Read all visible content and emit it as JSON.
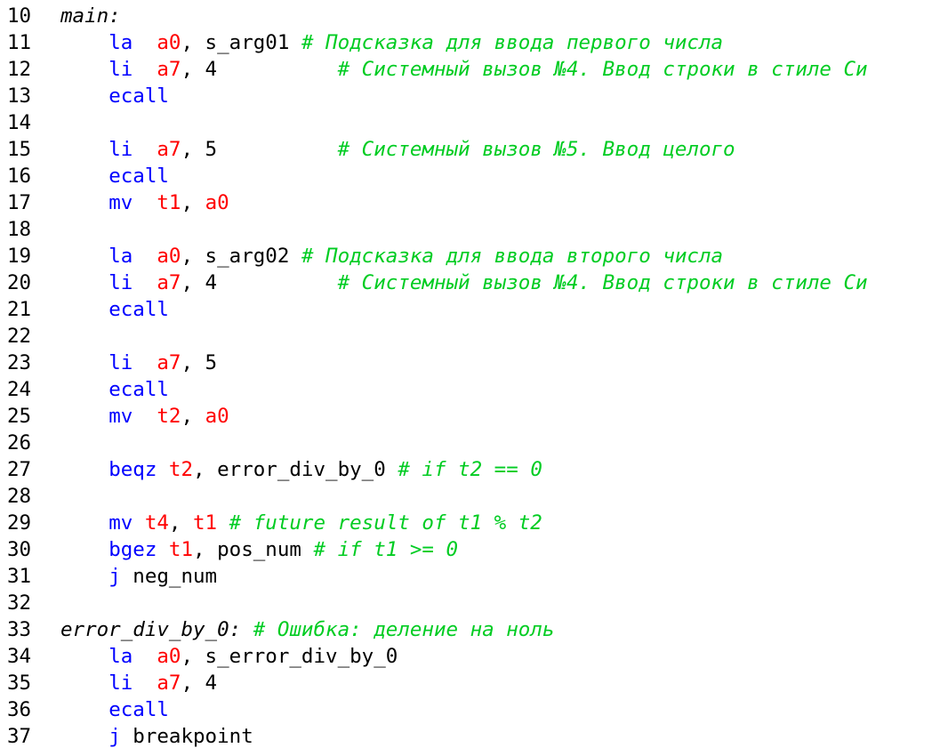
{
  "editor": {
    "colors": {
      "instruction": "#0000ff",
      "register": "#ff0000",
      "comment": "#00cc22",
      "text": "#000000",
      "background": "#ffffff"
    },
    "lines": [
      {
        "num": "10",
        "tokens": [
          {
            "t": "main:",
            "k": "label"
          }
        ]
      },
      {
        "num": "11",
        "tokens": [
          {
            "t": "    "
          },
          {
            "t": "la",
            "k": "instr"
          },
          {
            "t": "  "
          },
          {
            "t": "a0",
            "k": "reg"
          },
          {
            "t": ", s_arg01 "
          },
          {
            "t": "# Подсказка для ввода первого числа",
            "k": "comment"
          }
        ]
      },
      {
        "num": "12",
        "tokens": [
          {
            "t": "    "
          },
          {
            "t": "li",
            "k": "instr"
          },
          {
            "t": "  "
          },
          {
            "t": "a7",
            "k": "reg"
          },
          {
            "t": ", 4          "
          },
          {
            "t": "# Системный вызов №4. Ввод строки в стиле Си",
            "k": "comment"
          }
        ]
      },
      {
        "num": "13",
        "tokens": [
          {
            "t": "    "
          },
          {
            "t": "ecall",
            "k": "instr"
          }
        ]
      },
      {
        "num": "14",
        "tokens": []
      },
      {
        "num": "15",
        "tokens": [
          {
            "t": "    "
          },
          {
            "t": "li",
            "k": "instr"
          },
          {
            "t": "  "
          },
          {
            "t": "a7",
            "k": "reg"
          },
          {
            "t": ", 5          "
          },
          {
            "t": "# Системный вызов №5. Ввод целого",
            "k": "comment"
          }
        ]
      },
      {
        "num": "16",
        "tokens": [
          {
            "t": "    "
          },
          {
            "t": "ecall",
            "k": "instr"
          }
        ]
      },
      {
        "num": "17",
        "tokens": [
          {
            "t": "    "
          },
          {
            "t": "mv",
            "k": "instr"
          },
          {
            "t": "  "
          },
          {
            "t": "t1",
            "k": "reg"
          },
          {
            "t": ", "
          },
          {
            "t": "a0",
            "k": "reg"
          }
        ]
      },
      {
        "num": "18",
        "tokens": []
      },
      {
        "num": "19",
        "tokens": [
          {
            "t": "    "
          },
          {
            "t": "la",
            "k": "instr"
          },
          {
            "t": "  "
          },
          {
            "t": "a0",
            "k": "reg"
          },
          {
            "t": ", s_arg02 "
          },
          {
            "t": "# Подсказка для ввода второго числа",
            "k": "comment"
          }
        ]
      },
      {
        "num": "20",
        "tokens": [
          {
            "t": "    "
          },
          {
            "t": "li",
            "k": "instr"
          },
          {
            "t": "  "
          },
          {
            "t": "a7",
            "k": "reg"
          },
          {
            "t": ", 4          "
          },
          {
            "t": "# Системный вызов №4. Ввод строки в стиле Си",
            "k": "comment"
          }
        ]
      },
      {
        "num": "21",
        "tokens": [
          {
            "t": "    "
          },
          {
            "t": "ecall",
            "k": "instr"
          }
        ]
      },
      {
        "num": "22",
        "tokens": []
      },
      {
        "num": "23",
        "tokens": [
          {
            "t": "    "
          },
          {
            "t": "li",
            "k": "instr"
          },
          {
            "t": "  "
          },
          {
            "t": "a7",
            "k": "reg"
          },
          {
            "t": ", 5"
          }
        ]
      },
      {
        "num": "24",
        "tokens": [
          {
            "t": "    "
          },
          {
            "t": "ecall",
            "k": "instr"
          }
        ]
      },
      {
        "num": "25",
        "tokens": [
          {
            "t": "    "
          },
          {
            "t": "mv",
            "k": "instr"
          },
          {
            "t": "  "
          },
          {
            "t": "t2",
            "k": "reg"
          },
          {
            "t": ", "
          },
          {
            "t": "a0",
            "k": "reg"
          }
        ]
      },
      {
        "num": "26",
        "tokens": []
      },
      {
        "num": "27",
        "tokens": [
          {
            "t": "    "
          },
          {
            "t": "beqz",
            "k": "instr"
          },
          {
            "t": " "
          },
          {
            "t": "t2",
            "k": "reg"
          },
          {
            "t": ", error_div_by_0 "
          },
          {
            "t": "# if t2 == 0",
            "k": "comment"
          }
        ]
      },
      {
        "num": "28",
        "tokens": []
      },
      {
        "num": "29",
        "tokens": [
          {
            "t": "    "
          },
          {
            "t": "mv",
            "k": "instr"
          },
          {
            "t": " "
          },
          {
            "t": "t4",
            "k": "reg"
          },
          {
            "t": ", "
          },
          {
            "t": "t1",
            "k": "reg"
          },
          {
            "t": " "
          },
          {
            "t": "# future result of t1 % t2",
            "k": "comment"
          }
        ]
      },
      {
        "num": "30",
        "tokens": [
          {
            "t": "    "
          },
          {
            "t": "bgez",
            "k": "instr"
          },
          {
            "t": " "
          },
          {
            "t": "t1",
            "k": "reg"
          },
          {
            "t": ", pos_num "
          },
          {
            "t": "# if t1 >= 0",
            "k": "comment"
          }
        ]
      },
      {
        "num": "31",
        "tokens": [
          {
            "t": "    "
          },
          {
            "t": "j",
            "k": "instr"
          },
          {
            "t": " neg_num"
          }
        ]
      },
      {
        "num": "32",
        "tokens": []
      },
      {
        "num": "33",
        "tokens": [
          {
            "t": "error_div_by_0:",
            "k": "label"
          },
          {
            "t": " "
          },
          {
            "t": "# Ошибка: деление на ноль",
            "k": "comment"
          }
        ]
      },
      {
        "num": "34",
        "tokens": [
          {
            "t": "    "
          },
          {
            "t": "la",
            "k": "instr"
          },
          {
            "t": "  "
          },
          {
            "t": "a0",
            "k": "reg"
          },
          {
            "t": ", s_error_div_by_0"
          }
        ]
      },
      {
        "num": "35",
        "tokens": [
          {
            "t": "    "
          },
          {
            "t": "li",
            "k": "instr"
          },
          {
            "t": "  "
          },
          {
            "t": "a7",
            "k": "reg"
          },
          {
            "t": ", 4"
          }
        ]
      },
      {
        "num": "36",
        "tokens": [
          {
            "t": "    "
          },
          {
            "t": "ecall",
            "k": "instr"
          }
        ]
      },
      {
        "num": "37",
        "tokens": [
          {
            "t": "    "
          },
          {
            "t": "j",
            "k": "instr"
          },
          {
            "t": " breakpoint"
          }
        ]
      }
    ]
  }
}
